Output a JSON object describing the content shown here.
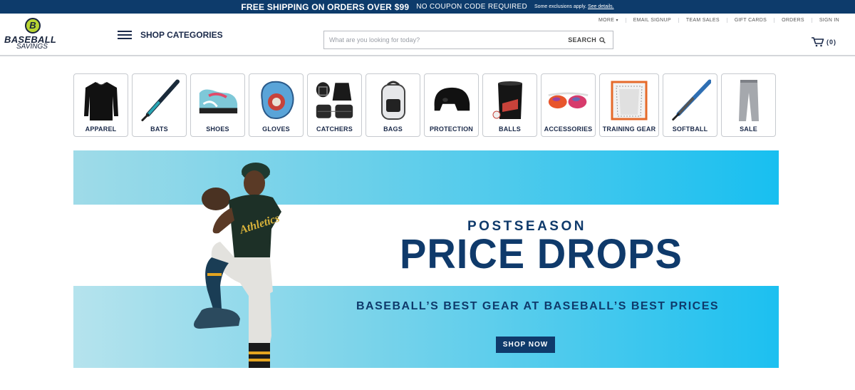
{
  "promo": {
    "main": "FREE SHIPPING ON ORDERS OVER $99",
    "sub": "NO COUPON CODE REQUIRED",
    "tiny": "Some exclusions apply.",
    "link": "See details."
  },
  "logo": {
    "letter": "B",
    "word1": "BASEBALL",
    "word2": "SAVINGS"
  },
  "nav": {
    "shop_categories": "SHOP CATEGORIES"
  },
  "search": {
    "placeholder": "What are you looking for today?",
    "button": "SEARCH"
  },
  "util_links": [
    "MORE",
    "EMAIL SIGNUP",
    "TEAM SALES",
    "GIFT CARDS",
    "ORDERS",
    "SIGN IN"
  ],
  "cart": {
    "count": "(0)"
  },
  "categories": [
    {
      "label": "APPAREL",
      "icon": "shirt-icon"
    },
    {
      "label": "BATS",
      "icon": "bat-icon"
    },
    {
      "label": "SHOES",
      "icon": "shoe-icon"
    },
    {
      "label": "GLOVES",
      "icon": "glove-icon"
    },
    {
      "label": "CATCHERS",
      "icon": "catchers-gear-icon"
    },
    {
      "label": "BAGS",
      "icon": "bag-icon"
    },
    {
      "label": "PROTECTION",
      "icon": "helmet-icon"
    },
    {
      "label": "BALLS",
      "icon": "ball-bucket-icon"
    },
    {
      "label": "ACCESSORIES",
      "icon": "sunglasses-icon"
    },
    {
      "label": "TRAINING GEAR",
      "icon": "net-icon"
    },
    {
      "label": "SOFTBALL",
      "icon": "softball-bat-icon"
    },
    {
      "label": "SALE",
      "icon": "pants-icon"
    }
  ],
  "hero": {
    "kicker": "POSTSEASON",
    "headline": "PRICE DROPS",
    "tagline": "BASEBALL’S BEST GEAR AT BASEBALL’S BEST PRICES",
    "cta": "SHOP NOW"
  },
  "colors": {
    "navy": "#0d3b6b",
    "cyan": "#18bff0",
    "lime": "#b8d432"
  }
}
